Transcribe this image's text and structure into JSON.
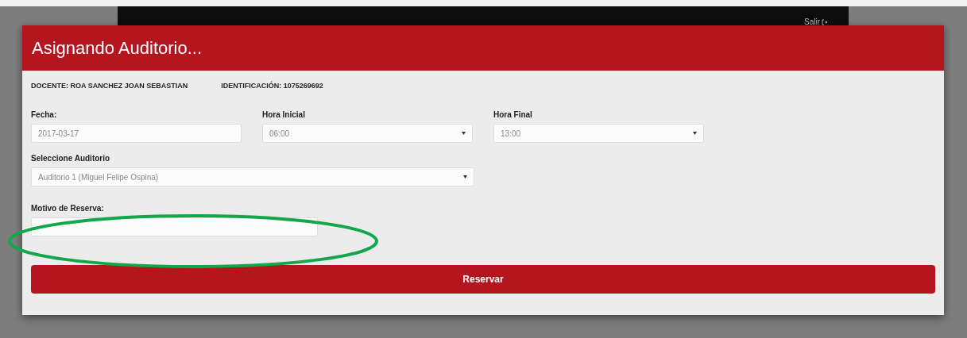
{
  "navbar": {
    "logout_label": "Salir"
  },
  "modal": {
    "title": "Asignando Auditorio...",
    "docente": "DOCENTE: ROA SANCHEZ JOAN SEBASTIAN",
    "identificacion": "IDENTIFICACIÓN: 1075269692",
    "fields": [
      {
        "kind": "text",
        "label": "Fecha:",
        "value": "2017-03-17"
      },
      {
        "kind": "select",
        "label": "Hora Inicial",
        "value": "06:00"
      },
      {
        "kind": "select",
        "label": "Hora Final",
        "value": "13:00"
      }
    ],
    "auditorium": {
      "kind": "select",
      "label": "Seleccione Auditorio",
      "value": "Auditorio 1 (Miguel Felipe Ospina)"
    },
    "reason": {
      "kind": "text",
      "label": "Motivo de Reserva:"
    },
    "submit": "Reservar"
  }
}
